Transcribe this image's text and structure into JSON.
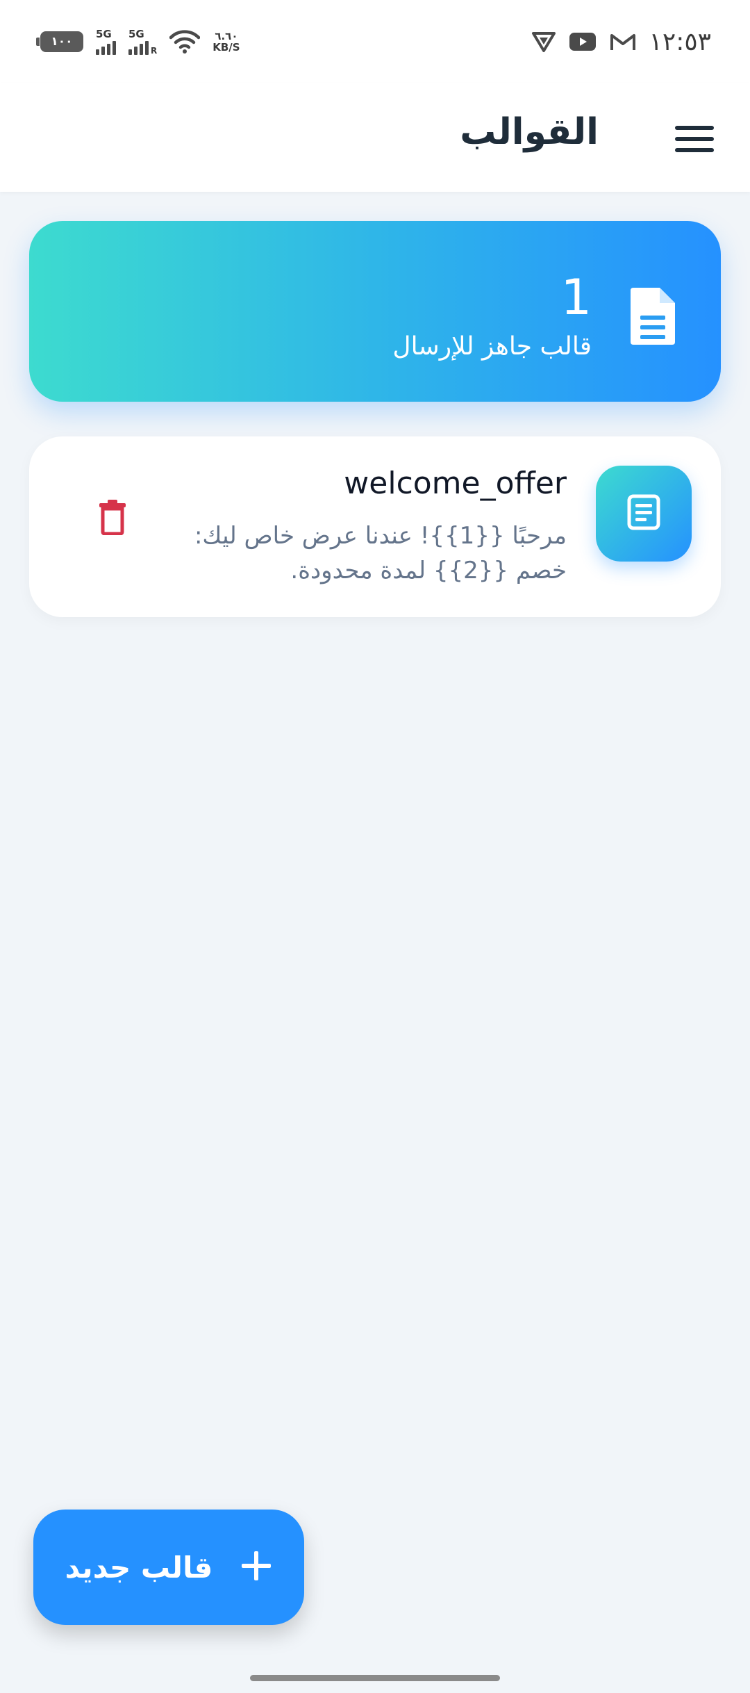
{
  "status_bar": {
    "time": "١٢:٥٣",
    "battery": "١٠٠",
    "signal_1": "5G",
    "signal_2": "5G",
    "signal_2_sub": "R",
    "net_speed_value": "٦.٦٠",
    "net_speed_unit": "KB/S"
  },
  "header": {
    "title": "القوالب"
  },
  "summary": {
    "count": "1",
    "label": "قالب جاهز للإرسال"
  },
  "templates": [
    {
      "name": "welcome_offer",
      "body": "مرحبًا {{1}}! عندنا عرض خاص ليك: خصم {{2}} لمدة محدودة."
    }
  ],
  "fab": {
    "label": "قالب جديد"
  },
  "colors": {
    "primary": "#2591ff",
    "accent_teal": "#3ddbcf",
    "delete_red": "#d6334a",
    "title_dark": "#1f2d3a",
    "background": "#f1f5f9"
  },
  "icons": {
    "menu": "hamburger-icon",
    "summary": "document-icon",
    "template": "document-lines-icon",
    "delete": "trash-icon",
    "fab": "plus-icon"
  }
}
